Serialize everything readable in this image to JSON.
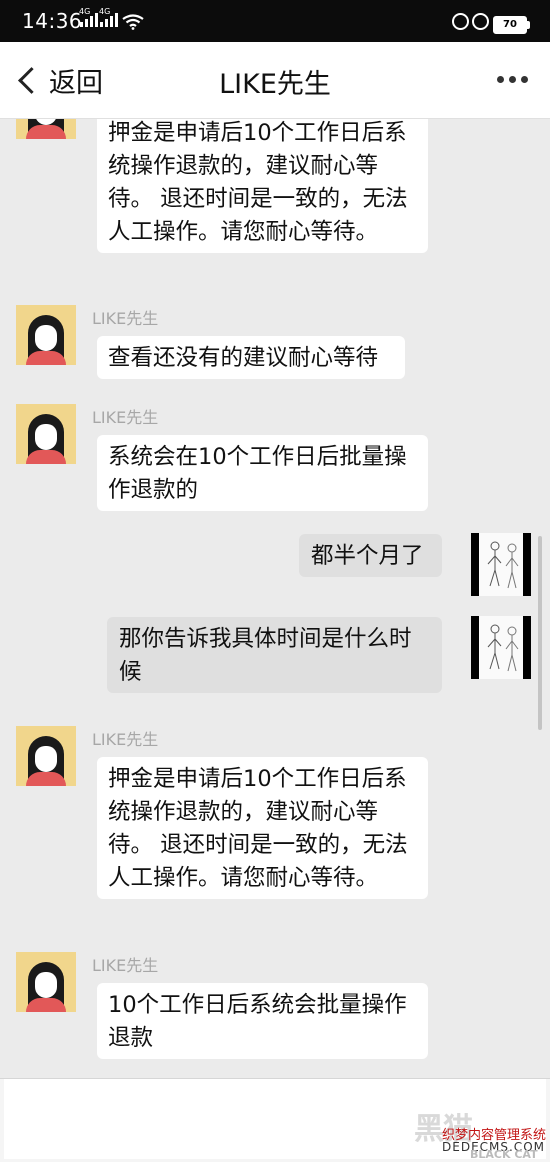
{
  "status_bar": {
    "time": "14:36",
    "network_1": "4G",
    "network_2": "4G",
    "battery": "70"
  },
  "nav": {
    "back_label": "返回",
    "title": "LIKE先生",
    "more_icon": "more-dots-icon"
  },
  "messages": [
    {
      "side": "in",
      "sender": "",
      "text": "押金是申请后10个工作日后系统操作退款的，建议耐心等待。 退还时间是一致的，无法人工操作。请您耐心等待。"
    },
    {
      "side": "in",
      "sender": "LIKE先生",
      "text": "查看还没有的建议耐心等待"
    },
    {
      "side": "in",
      "sender": "LIKE先生",
      "text": "系统会在10个工作日后批量操作退款的"
    },
    {
      "side": "out",
      "text": "都半个月了"
    },
    {
      "side": "out",
      "text": "那你告诉我具体时间是什么时候"
    },
    {
      "side": "in",
      "sender": "LIKE先生",
      "text": "押金是申请后10个工作日后系统操作退款的，建议耐心等待。 退还时间是一致的，无法人工操作。请您耐心等待。"
    },
    {
      "side": "in",
      "sender": "LIKE先生",
      "text": "10个工作日后系统会批量操作退款"
    }
  ],
  "watermark": {
    "logo": "黑猫",
    "site_name": "织梦内容管理系统",
    "url": "DEDECMS.COM",
    "brand": "BLACK CAT"
  },
  "colors": {
    "chat_bg": "#ebebeb",
    "incoming_bubble": "#ffffff",
    "outgoing_bubble": "#dfdfdf",
    "sender_name": "#a7a7a7"
  }
}
